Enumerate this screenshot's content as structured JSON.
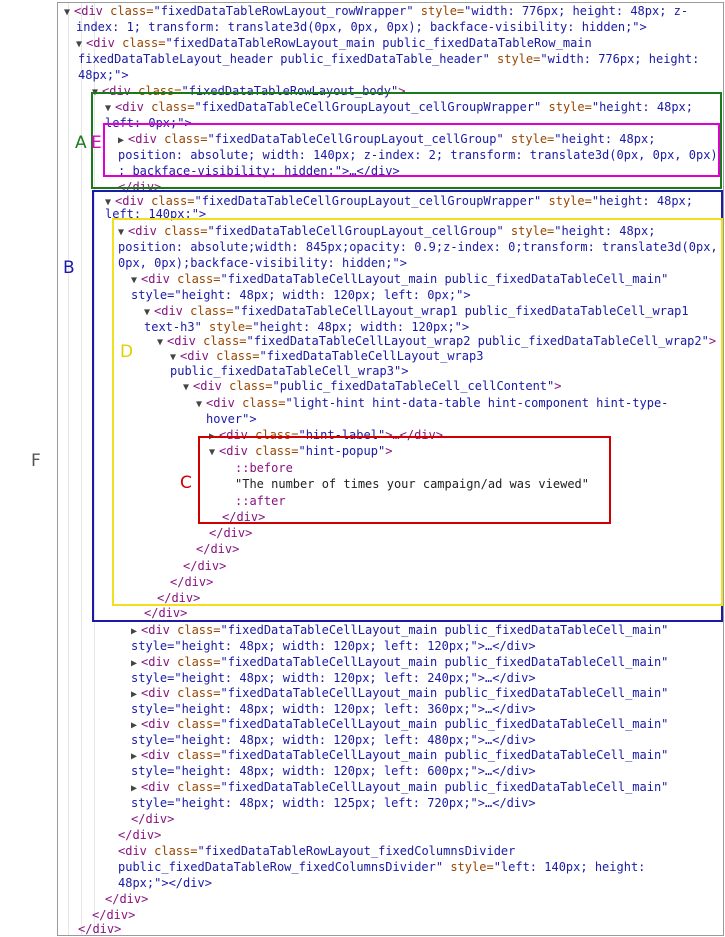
{
  "panel_lines": {
    "l01": {
      "tag_open": "<div",
      "attr1": " class=",
      "val1": "\"fixedDataTableRowLayout_rowWrapper\"",
      "attr2": " style=",
      "val2": "\"width: 776px; height: 48px; z-",
      "tail": ""
    },
    "l02": {
      "text": "index: 1; transform: translate3d(0px, 0px, 0px); backface-visibility: hidden;\">"
    },
    "l03": {
      "tag_open": "<div",
      "attr1": " class=",
      "val1": "\"fixedDataTableRowLayout_main public_fixedDataTableRow_main"
    },
    "l04": {
      "text": "fixedDataTableLayout_header public_fixedDataTable_header\"",
      "attr2": " style=",
      "val2": "\"width: 776px; height:"
    },
    "l05": {
      "text": "48px;\">"
    },
    "l06": {
      "tag_open": "<div",
      "attr1": " class=",
      "val1": "\"fixedDataTableRowLayout_body\"",
      "tail": ">"
    },
    "l07": {
      "tag_open": "<div",
      "attr1": " class=",
      "val1": "\"fixedDataTableCellGroupLayout_cellGroupWrapper\"",
      "attr2": " style=",
      "val2": "\"height: 48px;"
    },
    "l08": {
      "text": "left: 0px;\">"
    },
    "l09": {
      "tag_open": "<div",
      "attr1": " class=",
      "val1": "\"fixedDataTableCellGroupLayout_cellGroup\"",
      "attr2": " style=",
      "val2": "\"height: 48px;"
    },
    "l10": {
      "text": "position: absolute; width: 140px; z-index: 2; transform: translate3d(0px, 0px, 0px)"
    },
    "l11": {
      "text": "; backface-visibility: hidden;\">…</div>"
    },
    "l12": {
      "text": "</div>"
    },
    "l13": {
      "tag_open": "<div",
      "attr1": " class=",
      "val1": "\"fixedDataTableCellGroupLayout_cellGroupWrapper\"",
      "attr2": " style=",
      "val2": "\"height: 48px;"
    },
    "l14": {
      "text": "left: 140px;\">"
    },
    "l15": {
      "tag_open": "<div",
      "attr1": " class=",
      "val1": "\"fixedDataTableCellGroupLayout_cellGroup\"",
      "attr2": " style=",
      "val2": "\"height: 48px;"
    },
    "l16": {
      "text": "position: absolute;width: 845px;opacity: 0.9;z-index: 0;transform: translate3d(0px,"
    },
    "l17": {
      "text": "0px, 0px);backface-visibility: hidden;\">"
    },
    "l18": {
      "tag_open": "<div",
      "attr1": " class=",
      "val1": "\"fixedDataTableCellLayout_main public_fixedDataTableCell_main\""
    },
    "l19": {
      "text": "style=\"height: 48px; width: 120px; left: 0px;\">"
    },
    "l20": {
      "tag_open": "<div",
      "attr1": " class=",
      "val1": "\"fixedDataTableCellLayout_wrap1 public_fixedDataTableCell_wrap1"
    },
    "l21": {
      "text": "text-h3\"",
      "attr2": " style=",
      "val2": "\"height: 48px; width: 120px;\">"
    },
    "l22": {
      "tag_open": "<div",
      "attr1": " class=",
      "val1": "\"fixedDataTableCellLayout_wrap2 public_fixedDataTableCell_wrap2\"",
      "tail": ">"
    },
    "l23": {
      "tag_open": "<div",
      "attr1": " class=",
      "val1": "\"fixedDataTableCellLayout_wrap3"
    },
    "l24": {
      "text": "public_fixedDataTableCell_wrap3\">"
    },
    "l25": {
      "tag_open": "<div",
      "attr1": " class=",
      "val1": "\"public_fixedDataTableCell_cellContent\"",
      "tail": ">"
    },
    "l26": {
      "tag_open": "<div",
      "attr1": " class=",
      "val1": "\"light-hint hint-data-table hint-component hint-type-"
    },
    "l27": {
      "text": "hover\">"
    },
    "l28": {
      "tag_open": "<div",
      "attr1": " class=",
      "val1": "\"hint-label\"",
      "tail": ">…</div>"
    },
    "l29": {
      "tag_open": "<div",
      "attr1": " class=",
      "val1": "\"hint-popup\"",
      "tail": ">"
    },
    "l30": {
      "text": "::before"
    },
    "l31": {
      "text": "\"The number of times your campaign/ad was viewed\""
    },
    "l32": {
      "text": "::after"
    },
    "l33": {
      "text": "</div>"
    },
    "l34": {
      "text": "</div>"
    },
    "l35": {
      "text": "</div>"
    },
    "l36": {
      "text": "</div>"
    },
    "l37": {
      "text": "</div>"
    },
    "l38": {
      "text": "</div>"
    },
    "l39": {
      "text": "</div>"
    },
    "l40": {
      "tag_open": "<div",
      "attr1": " class=",
      "val1": "\"fixedDataTableCellLayout_main public_fixedDataTableCell_main\""
    },
    "l41": {
      "text": "style=\"height: 48px; width: 120px; left: 120px;\">…</div>"
    },
    "l42": {
      "tag_open": "<div",
      "attr1": " class=",
      "val1": "\"fixedDataTableCellLayout_main public_fixedDataTableCell_main\""
    },
    "l43": {
      "text": "style=\"height: 48px; width: 120px; left: 240px;\">…</div>"
    },
    "l44": {
      "tag_open": "<div",
      "attr1": " class=",
      "val1": "\"fixedDataTableCellLayout_main public_fixedDataTableCell_main\""
    },
    "l45": {
      "text": "style=\"height: 48px; width: 120px; left: 360px;\">…</div>"
    },
    "l46": {
      "tag_open": "<div",
      "attr1": " class=",
      "val1": "\"fixedDataTableCellLayout_main public_fixedDataTableCell_main\""
    },
    "l47": {
      "text": "style=\"height: 48px; width: 120px; left: 480px;\">…</div>"
    },
    "l48": {
      "tag_open": "<div",
      "attr1": " class=",
      "val1": "\"fixedDataTableCellLayout_main public_fixedDataTableCell_main\""
    },
    "l49": {
      "text": "style=\"height: 48px; width: 120px; left: 600px;\">…</div>"
    },
    "l50": {
      "tag_open": "<div",
      "attr1": " class=",
      "val1": "\"fixedDataTableCellLayout_main public_fixedDataTableCell_main\""
    },
    "l51": {
      "text": "style=\"height: 48px; width: 125px; left: 720px;\">…</div>"
    },
    "l52": {
      "text": "</div>"
    },
    "l53": {
      "text": "</div>"
    },
    "l54": {
      "tag_open": "<div",
      "attr1": " class=",
      "val1": "\"fixedDataTableRowLayout_fixedColumnsDivider"
    },
    "l55": {
      "text": "public_fixedDataTableRow_fixedColumnsDivider\"",
      "attr2": " style=",
      "val2": "\"left: 140px; height:"
    },
    "l56": {
      "text": "48px;\"></div>"
    },
    "l57": {
      "text": "</div>"
    },
    "l58": {
      "text": "</div>"
    },
    "l59": {
      "text": "</div>"
    }
  },
  "annotations": {
    "A": "A",
    "B": "B",
    "C": "C",
    "D": "D",
    "E": "E",
    "F": "F"
  },
  "colors": {
    "box_A": "#1a7a1a",
    "box_B": "#1a1aa6",
    "box_C": "#d10000",
    "box_D": "#f0e020",
    "box_E": "#e000d0",
    "label_F": "#555555"
  }
}
